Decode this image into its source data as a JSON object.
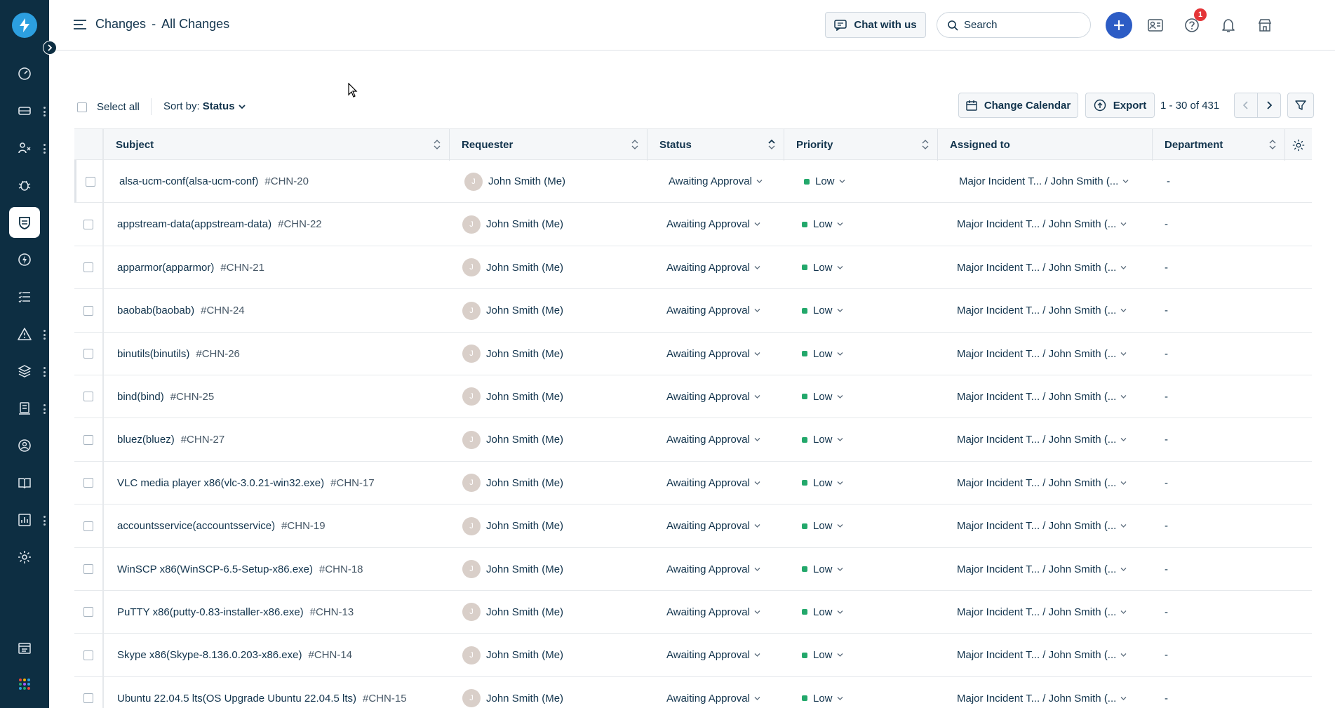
{
  "header": {
    "title_module": "Changes",
    "title_separator": "-",
    "title_view": "All Changes",
    "chat_label": "Chat with us",
    "search_placeholder": "Search",
    "help_badge_count": "1",
    "avatar_initial": "J"
  },
  "toolbar": {
    "select_all_label": "Select all",
    "sort_prefix": "Sort by:",
    "sort_value": "Status",
    "change_calendar_label": "Change Calendar",
    "export_label": "Export",
    "pagination_text": "1 - 30 of 431"
  },
  "table": {
    "columns": {
      "subject": "Subject",
      "requester": "Requester",
      "status": "Status",
      "priority": "Priority",
      "assigned_to": "Assigned to",
      "department": "Department"
    },
    "rows": [
      {
        "subject": "alsa-ucm-conf(alsa-ucm-conf)",
        "id": "#CHN-20",
        "requester": "John Smith (Me)",
        "status": "Awaiting Approval",
        "priority": "Low",
        "assigned": "Major Incident T... / John Smith (...",
        "department": "-"
      },
      {
        "subject": "appstream-data(appstream-data)",
        "id": "#CHN-22",
        "requester": "John Smith (Me)",
        "status": "Awaiting Approval",
        "priority": "Low",
        "assigned": "Major Incident T... / John Smith (...",
        "department": "-"
      },
      {
        "subject": "apparmor(apparmor)",
        "id": "#CHN-21",
        "requester": "John Smith (Me)",
        "status": "Awaiting Approval",
        "priority": "Low",
        "assigned": "Major Incident T... / John Smith (...",
        "department": "-"
      },
      {
        "subject": "baobab(baobab)",
        "id": "#CHN-24",
        "requester": "John Smith (Me)",
        "status": "Awaiting Approval",
        "priority": "Low",
        "assigned": "Major Incident T... / John Smith (...",
        "department": "-"
      },
      {
        "subject": "binutils(binutils)",
        "id": "#CHN-26",
        "requester": "John Smith (Me)",
        "status": "Awaiting Approval",
        "priority": "Low",
        "assigned": "Major Incident T... / John Smith (...",
        "department": "-"
      },
      {
        "subject": "bind(bind)",
        "id": "#CHN-25",
        "requester": "John Smith (Me)",
        "status": "Awaiting Approval",
        "priority": "Low",
        "assigned": "Major Incident T... / John Smith (...",
        "department": "-"
      },
      {
        "subject": "bluez(bluez)",
        "id": "#CHN-27",
        "requester": "John Smith (Me)",
        "status": "Awaiting Approval",
        "priority": "Low",
        "assigned": "Major Incident T... / John Smith (...",
        "department": "-"
      },
      {
        "subject": "VLC media player x86(vlc-3.0.21-win32.exe)",
        "id": "#CHN-17",
        "requester": "John Smith (Me)",
        "status": "Awaiting Approval",
        "priority": "Low",
        "assigned": "Major Incident T... / John Smith (...",
        "department": "-"
      },
      {
        "subject": "accountsservice(accountsservice)",
        "id": "#CHN-19",
        "requester": "John Smith (Me)",
        "status": "Awaiting Approval",
        "priority": "Low",
        "assigned": "Major Incident T... / John Smith (...",
        "department": "-"
      },
      {
        "subject": "WinSCP x86(WinSCP-6.5-Setup-x86.exe)",
        "id": "#CHN-18",
        "requester": "John Smith (Me)",
        "status": "Awaiting Approval",
        "priority": "Low",
        "assigned": "Major Incident T... / John Smith (...",
        "department": "-"
      },
      {
        "subject": "PuTTY x86(putty-0.83-installer-x86.exe)",
        "id": "#CHN-13",
        "requester": "John Smith (Me)",
        "status": "Awaiting Approval",
        "priority": "Low",
        "assigned": "Major Incident T... / John Smith (...",
        "department": "-"
      },
      {
        "subject": "Skype x86(Skype-8.136.0.203-x86.exe)",
        "id": "#CHN-14",
        "requester": "John Smith (Me)",
        "status": "Awaiting Approval",
        "priority": "Low",
        "assigned": "Major Incident T... / John Smith (...",
        "department": "-"
      },
      {
        "subject": "Ubuntu 22.04.5 lts(OS Upgrade Ubuntu 22.04.5 lts)",
        "id": "#CHN-15",
        "requester": "John Smith (Me)",
        "status": "Awaiting Approval",
        "priority": "Low",
        "assigned": "Major Incident T... / John Smith (...",
        "department": "-"
      }
    ],
    "requester_avatar_initial": "J"
  },
  "colors": {
    "sidebar_bg": "#0d2e42",
    "accent_blue": "#2c5cc5",
    "priority_low": "#23a86b",
    "badge_red": "#e43538"
  },
  "sidebar_icons": [
    "dashboard-icon",
    "tickets-icon",
    "problems-icon",
    "bug-icon",
    "changes-icon",
    "releases-icon",
    "tasks-icon",
    "alerts-icon",
    "assets-icon",
    "inventory-icon",
    "support-icon",
    "solutions-icon",
    "reports-icon",
    "settings-icon",
    "workspace-icon",
    "apps-grid-icon"
  ]
}
